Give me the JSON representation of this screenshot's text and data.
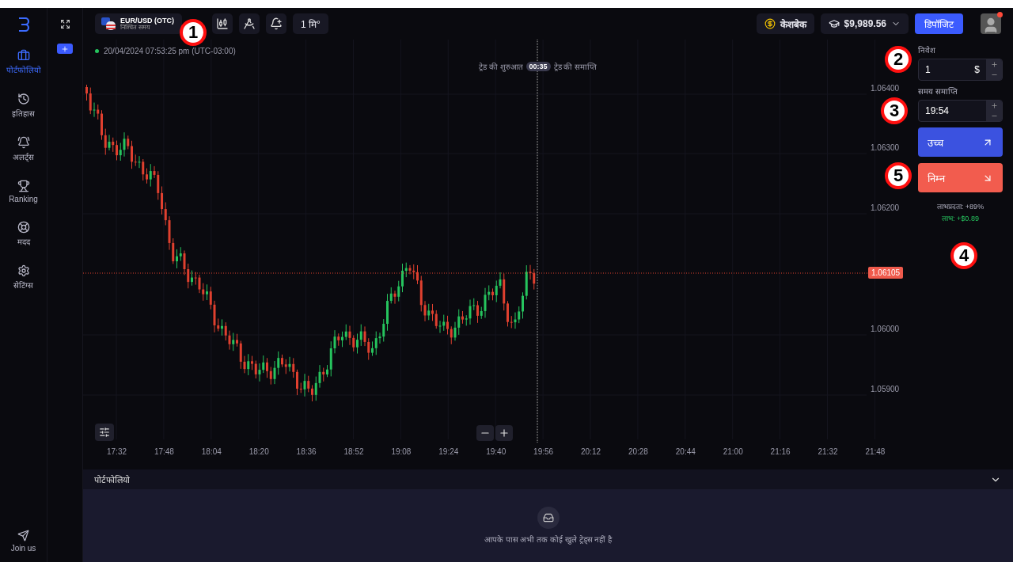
{
  "sidebar": {
    "items": [
      {
        "label": "पोर्टफोलियो",
        "selected": true
      },
      {
        "label": "इतिहास",
        "selected": false
      },
      {
        "label": "अलर्ट्स",
        "selected": false
      },
      {
        "label": "Ranking",
        "selected": false
      },
      {
        "label": "मदद",
        "selected": false
      },
      {
        "label": "सेटिंग्स",
        "selected": false
      }
    ],
    "footer": "Join us"
  },
  "toolbar": {
    "asset": {
      "name": "EUR/USD (OTC)",
      "subtitle": "निश्चित समय"
    },
    "timeframe": "1 मि°",
    "cashback": "केशबेक",
    "balance": "$9,989.56",
    "deposit": "डिपॉजिट",
    "notification": true
  },
  "chart": {
    "status": "20/04/2024  07:53:25 pm (UTC-03:00)",
    "trade_start": "ट्रेड की शुरुआत",
    "timer": "00:35",
    "trade_end": "ट्रेड की समाप्ति",
    "price_label": "1.06105",
    "yticks": [
      "1.06400",
      "1.06300",
      "1.06200",
      "1.06000",
      "1.05900"
    ],
    "xticks": [
      "17:32",
      "17:48",
      "18:04",
      "18:20",
      "18:36",
      "18:52",
      "19:08",
      "19:24",
      "19:40",
      "19:56",
      "20:12",
      "20:28",
      "20:44",
      "21:00",
      "21:16",
      "21:32",
      "21:48"
    ]
  },
  "trade_panel": {
    "investment": {
      "label": "निवेश",
      "value": "1",
      "currency": "$"
    },
    "expiry": {
      "label": "समय समाप्ति",
      "value": "19:54"
    },
    "buttons": [
      {
        "kind": "up",
        "label": "उच्च"
      },
      {
        "kind": "down",
        "label": "निम्न"
      }
    ],
    "payout": "लाभप्रदता: +89%",
    "profit": "लाभ: +$0.89"
  },
  "portfolio": {
    "title": "पोर्टफोलियो",
    "expanded": true,
    "empty_message": "आपके पास अभी तक कोई खुले ट्रेड्स नहीं है"
  },
  "annotations": [
    {
      "label": "1"
    },
    {
      "label": "2"
    },
    {
      "label": "3"
    },
    {
      "label": "4"
    },
    {
      "label": "5"
    }
  ]
}
